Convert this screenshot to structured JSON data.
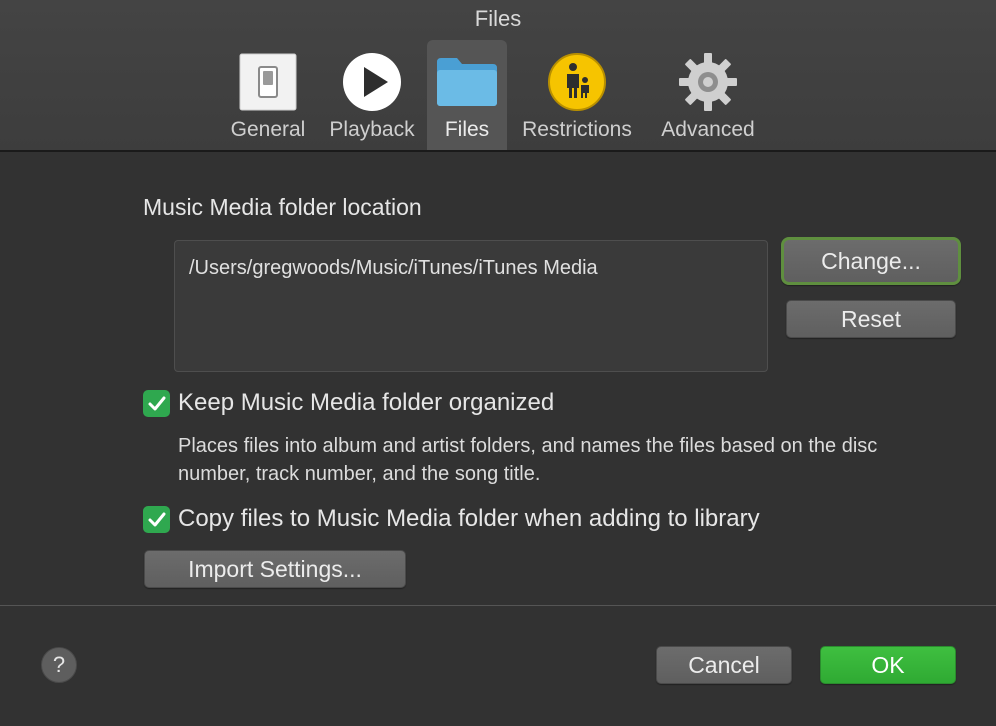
{
  "window": {
    "title": "Files"
  },
  "toolbar": {
    "tabs": [
      {
        "label": "General",
        "icon": "toggle-switch-icon",
        "selected": false
      },
      {
        "label": "Playback",
        "icon": "play-icon",
        "selected": false
      },
      {
        "label": "Files",
        "icon": "folder-icon",
        "selected": true
      },
      {
        "label": "Restrictions",
        "icon": "parental-controls-icon",
        "selected": false
      },
      {
        "label": "Advanced",
        "icon": "gear-icon",
        "selected": false
      }
    ]
  },
  "location": {
    "title": "Music Media folder location",
    "path": "/Users/gregwoods/Music/iTunes/iTunes Media",
    "change_label": "Change...",
    "reset_label": "Reset"
  },
  "options": {
    "keep_organized": {
      "label": "Keep Music Media folder organized",
      "checked": true,
      "description": "Places files into album and artist folders, and names the files based on the disc number, track number, and the song title."
    },
    "copy_files": {
      "label": "Copy files to Music Media folder when adding to library",
      "checked": true
    },
    "import_settings_label": "Import Settings..."
  },
  "footer": {
    "help_label": "?",
    "cancel_label": "Cancel",
    "ok_label": "OK"
  },
  "colors": {
    "accent_green": "#2fa84f",
    "ok_button": "#3cb93d",
    "focus_ring": "#5f8f3f"
  }
}
